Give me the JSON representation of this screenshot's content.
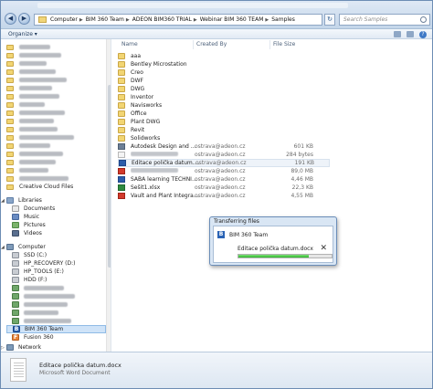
{
  "address": {
    "crumbs": [
      "Computer",
      "BIM 360 Team",
      "ADEON BIM360 TRIAL",
      "Webinar BIM 360 TEAM",
      "Samples"
    ],
    "search_placeholder": "Search Samples"
  },
  "toolbar": {
    "organize": "Organize ▾"
  },
  "nav": {
    "creative_cloud": "Creative Cloud Files",
    "libraries": "Libraries",
    "documents": "Documents",
    "music": "Music",
    "pictures": "Pictures",
    "videos": "Videos",
    "computer": "Computer",
    "ssd": "SSD (C:)",
    "hp_recovery": "HP_RECOVERY (D:)",
    "hp_tools": "HP_TOOLS (E:)",
    "hdd": "HDD (F:)",
    "bim360": "BIM 360 Team",
    "fusion360": "Fusion 360",
    "network": "Network"
  },
  "columns": {
    "name": "Name",
    "created_by": "Created By",
    "file_size": "File Size"
  },
  "files": [
    {
      "name": "aaa",
      "type": "folder",
      "by": "",
      "size": ""
    },
    {
      "name": "Bentley Microstation",
      "type": "folder",
      "by": "",
      "size": ""
    },
    {
      "name": "Creo",
      "type": "folder",
      "by": "",
      "size": ""
    },
    {
      "name": "DWF",
      "type": "folder",
      "by": "",
      "size": ""
    },
    {
      "name": "DWG",
      "type": "folder",
      "by": "",
      "size": ""
    },
    {
      "name": "Inventor",
      "type": "folder",
      "by": "",
      "size": ""
    },
    {
      "name": "Navisworks",
      "type": "folder",
      "by": "",
      "size": ""
    },
    {
      "name": "Office",
      "type": "folder",
      "by": "",
      "size": ""
    },
    {
      "name": "Plant DWG",
      "type": "folder",
      "by": "",
      "size": ""
    },
    {
      "name": "Revit",
      "type": "folder",
      "by": "",
      "size": ""
    },
    {
      "name": "Solidworks",
      "type": "folder",
      "by": "",
      "size": ""
    },
    {
      "name": "Autodesk Design and Me...",
      "type": "app",
      "by": "ostrava@adeon.cz",
      "size": "601 KB"
    },
    {
      "name": "",
      "type": "blank",
      "by": "ostrava@adeon.cz",
      "size": "284 bytes"
    },
    {
      "name": "Editace polička datum.docx",
      "type": "doc",
      "by": "ostrava@adeon.cz",
      "size": "191 KB"
    },
    {
      "name": "",
      "type": "pdf",
      "by": "ostrava@adeon.cz",
      "size": "89,0 MB"
    },
    {
      "name": "SABA learning TECHNICA...",
      "type": "doc",
      "by": "ostrava@adeon.cz",
      "size": "4,46 MB"
    },
    {
      "name": "Sešit1.xlsx",
      "type": "xls",
      "by": "ostrava@adeon.cz",
      "size": "22,3 KB"
    },
    {
      "name": "Vault and Plant Integratio...",
      "type": "pdf",
      "by": "ostrava@adeon.cz",
      "size": "4,55 MB"
    }
  ],
  "dialog": {
    "title": "Transferring files",
    "source": "BIM 360 Team",
    "file": "Editace polička datum.docx",
    "progress": 0.75
  },
  "details": {
    "name": "Editace polička datum.docx",
    "type": "Microsoft Word Document"
  },
  "colors": {
    "folder": "#f2d573",
    "accent": "#2a63b5",
    "progress": "#2fb52b"
  }
}
